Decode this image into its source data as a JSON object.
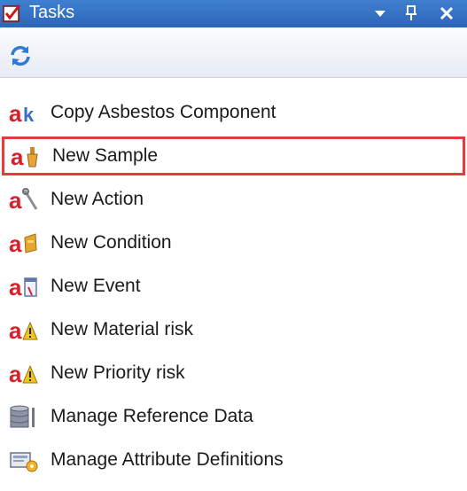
{
  "panel": {
    "title": "Tasks",
    "title_icon": "checkbox-icon",
    "controls": [
      "dropdown-icon",
      "pin-icon",
      "close-icon"
    ]
  },
  "toolbar": {
    "refresh_icon": "refresh-icon"
  },
  "tasks": [
    {
      "label": "Copy Asbestos Component",
      "icon": "copy-asbestos-component-icon",
      "selected": false
    },
    {
      "label": "New Sample",
      "icon": "new-sample-icon",
      "selected": true
    },
    {
      "label": "New Action",
      "icon": "new-action-icon",
      "selected": false
    },
    {
      "label": "New Condition",
      "icon": "new-condition-icon",
      "selected": false
    },
    {
      "label": "New Event",
      "icon": "new-event-icon",
      "selected": false
    },
    {
      "label": "New Material risk",
      "icon": "new-material-risk-icon",
      "selected": false
    },
    {
      "label": "New Priority risk",
      "icon": "new-priority-risk-icon",
      "selected": false
    },
    {
      "label": "Manage Reference Data",
      "icon": "database-icon",
      "selected": false
    },
    {
      "label": "Manage Attribute Definitions",
      "icon": "attribute-definitions-icon",
      "selected": false
    }
  ],
  "colors": {
    "titlebar": "#2c66b8",
    "selection_border": "#e23c3c",
    "asbestos_red": "#d8202a"
  }
}
